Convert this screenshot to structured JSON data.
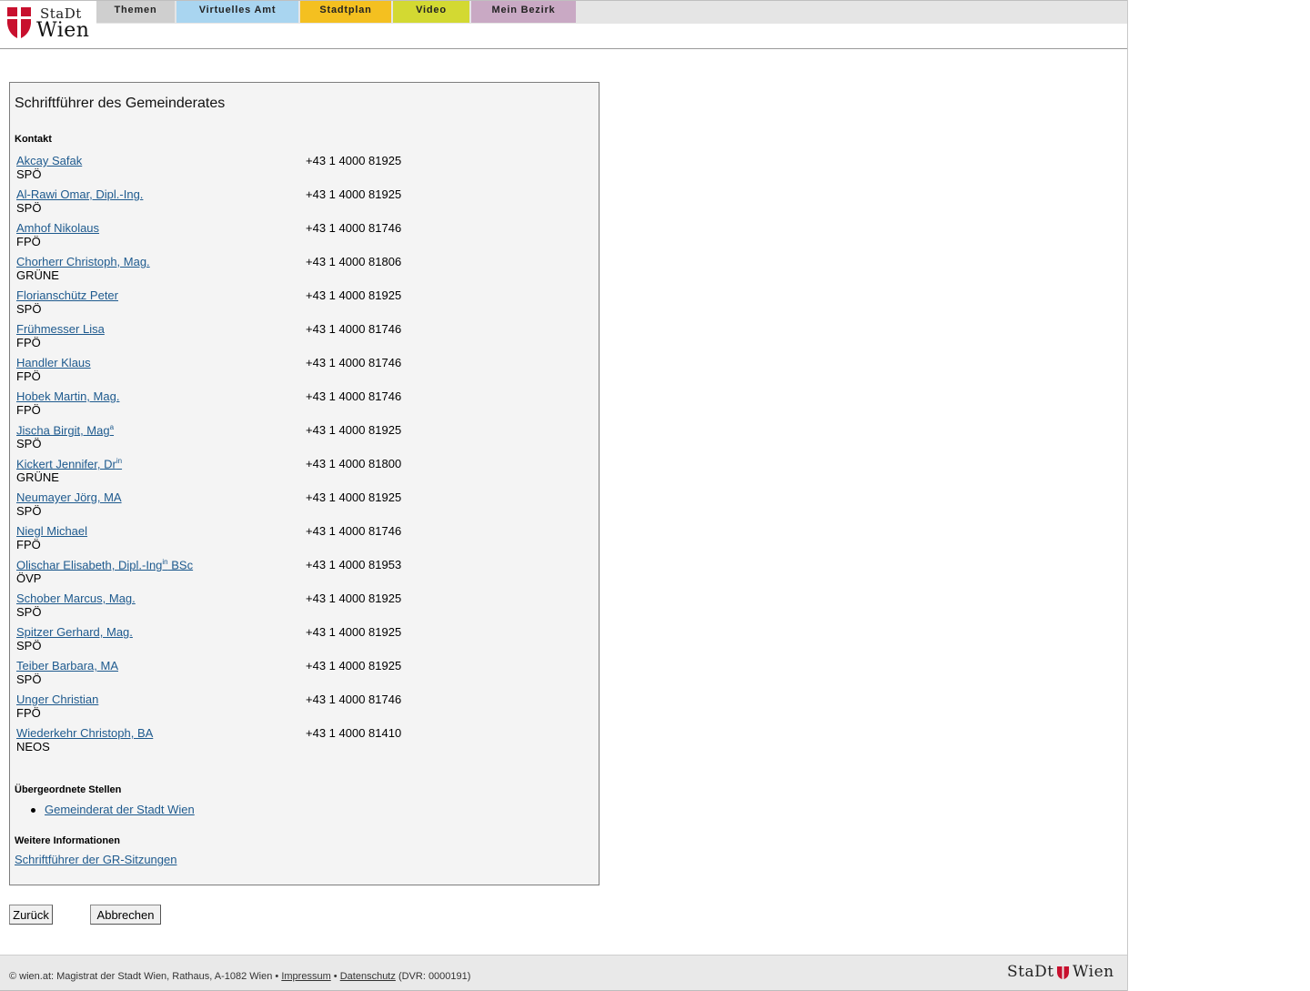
{
  "header": {
    "logo_text_top": "StaDt",
    "logo_text_bottom": "Wien",
    "tabs": [
      {
        "label": "Themen",
        "color": "#cfcfcf"
      },
      {
        "label": "Virtuelles Amt",
        "color": "#a9d5f0"
      },
      {
        "label": "Stadtplan",
        "color": "#f4c020"
      },
      {
        "label": "Video",
        "color": "#d3d932"
      },
      {
        "label": "Mein Bezirk",
        "color": "#c9a9c4"
      }
    ]
  },
  "main": {
    "title": "Schriftführer des Gemeinderates",
    "contacts_heading": "Kontakt",
    "contacts": [
      {
        "name": "Akcay Safak",
        "sup": "",
        "name_suffix": "",
        "party": "SPÖ",
        "phone": "+43 1 4000 81925"
      },
      {
        "name": "Al-Rawi Omar, Dipl.-Ing.",
        "sup": "",
        "name_suffix": "",
        "party": "SPÖ",
        "phone": "+43 1 4000 81925"
      },
      {
        "name": "Amhof Nikolaus",
        "sup": "",
        "name_suffix": "",
        "party": "FPÖ",
        "phone": "+43 1 4000 81746"
      },
      {
        "name": "Chorherr Christoph, Mag.",
        "sup": "",
        "name_suffix": "",
        "party": "GRÜNE",
        "phone": "+43 1 4000 81806"
      },
      {
        "name": "Florianschütz Peter",
        "sup": "",
        "name_suffix": "",
        "party": "SPÖ",
        "phone": "+43 1 4000 81925"
      },
      {
        "name": "Frühmesser Lisa",
        "sup": "",
        "name_suffix": "",
        "party": "FPÖ",
        "phone": "+43 1 4000 81746"
      },
      {
        "name": "Handler Klaus",
        "sup": "",
        "name_suffix": "",
        "party": "FPÖ",
        "phone": "+43 1 4000 81746"
      },
      {
        "name": "Hobek Martin, Mag.",
        "sup": "",
        "name_suffix": "",
        "party": "FPÖ",
        "phone": "+43 1 4000 81746"
      },
      {
        "name": "Jischa Birgit, Mag",
        "sup": "a",
        "name_suffix": "",
        "party": "SPÖ",
        "phone": "+43 1 4000 81925"
      },
      {
        "name": "Kickert Jennifer, Dr",
        "sup": "in",
        "name_suffix": "",
        "party": "GRÜNE",
        "phone": "+43 1 4000 81800"
      },
      {
        "name": "Neumayer Jörg, MA",
        "sup": "",
        "name_suffix": "",
        "party": "SPÖ",
        "phone": "+43 1 4000 81925"
      },
      {
        "name": "Niegl Michael",
        "sup": "",
        "name_suffix": "",
        "party": "FPÖ",
        "phone": "+43 1 4000 81746"
      },
      {
        "name": "Olischar Elisabeth, Dipl.-Ing",
        "sup": "in",
        "name_suffix": " BSc",
        "party": "ÖVP",
        "phone": "+43 1 4000 81953"
      },
      {
        "name": "Schober Marcus, Mag.",
        "sup": "",
        "name_suffix": "",
        "party": "SPÖ",
        "phone": "+43 1 4000 81925"
      },
      {
        "name": "Spitzer Gerhard, Mag.",
        "sup": "",
        "name_suffix": "",
        "party": "SPÖ",
        "phone": "+43 1 4000 81925"
      },
      {
        "name": "Teiber Barbara, MA",
        "sup": "",
        "name_suffix": "",
        "party": "SPÖ",
        "phone": "+43 1 4000 81925"
      },
      {
        "name": "Unger Christian",
        "sup": "",
        "name_suffix": "",
        "party": "FPÖ",
        "phone": "+43 1 4000 81746"
      },
      {
        "name": "Wiederkehr Christoph, BA",
        "sup": "",
        "name_suffix": "",
        "party": "NEOS",
        "phone": "+43 1 4000 81410"
      }
    ],
    "parent_heading": "Übergeordnete Stellen",
    "parent_link": "Gemeinderat der Stadt Wien",
    "more_heading": "Weitere Informationen",
    "more_link": "Schriftführer der GR-Sitzungen"
  },
  "buttons": {
    "back": "Zurück",
    "cancel": "Abbrechen"
  },
  "footer": {
    "copyright": "© wien.at: Magistrat der Stadt Wien, Rathaus, A-1082 Wien •",
    "impressum": "Impressum",
    "separator": "•",
    "datenschutz": "Datenschutz",
    "dvr": "(DVR: 0000191)",
    "logo_left": "StaDt",
    "logo_right": "Wien"
  },
  "colors": {
    "link": "#1e5a8e",
    "brand_red": "#c8102e",
    "box_bg": "#f4f4f4"
  }
}
